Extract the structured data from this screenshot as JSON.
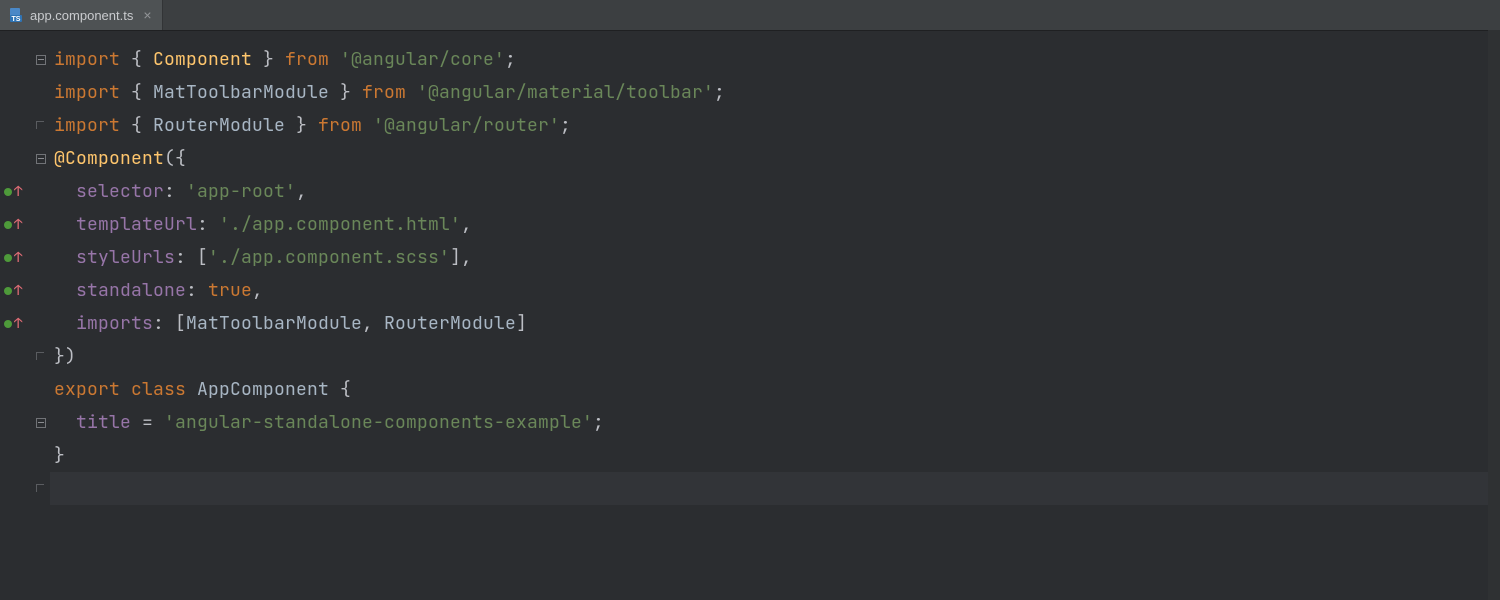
{
  "tab": {
    "filename": "app.component.ts",
    "icon": "ts-file-icon",
    "close": "×"
  },
  "gutter": {
    "vcs_rows": [
      4,
      5,
      6,
      7,
      8
    ],
    "fold_open_rows": [
      0,
      3,
      11
    ],
    "fold_close_rows": [
      2,
      9,
      13
    ]
  },
  "code": {
    "lines": [
      {
        "seg": [
          {
            "c": "kw",
            "t": "import"
          },
          {
            "c": "punc",
            "t": " { "
          },
          {
            "c": "cls",
            "t": "Component"
          },
          {
            "c": "punc",
            "t": " } "
          },
          {
            "c": "kw",
            "t": "from"
          },
          {
            "c": "punc",
            "t": " "
          },
          {
            "c": "str",
            "t": "'@angular/core'"
          },
          {
            "c": "punc",
            "t": ";"
          }
        ]
      },
      {
        "seg": [
          {
            "c": "kw",
            "t": "import"
          },
          {
            "c": "punc",
            "t": " { "
          },
          {
            "c": "plain",
            "t": "MatToolbarModule"
          },
          {
            "c": "punc",
            "t": " } "
          },
          {
            "c": "kw",
            "t": "from"
          },
          {
            "c": "punc",
            "t": " "
          },
          {
            "c": "str",
            "t": "'@angular/material/toolbar'"
          },
          {
            "c": "punc",
            "t": ";"
          }
        ]
      },
      {
        "seg": [
          {
            "c": "kw",
            "t": "import"
          },
          {
            "c": "punc",
            "t": " { "
          },
          {
            "c": "plain",
            "t": "RouterModule"
          },
          {
            "c": "punc",
            "t": " } "
          },
          {
            "c": "kw",
            "t": "from"
          },
          {
            "c": "punc",
            "t": " "
          },
          {
            "c": "str",
            "t": "'@angular/router'"
          },
          {
            "c": "punc",
            "t": ";"
          }
        ]
      },
      {
        "seg": [
          {
            "c": "cls",
            "t": "@Component"
          },
          {
            "c": "punc",
            "t": "({"
          }
        ]
      },
      {
        "indent": 1,
        "seg": [
          {
            "c": "prop",
            "t": "selector"
          },
          {
            "c": "punc",
            "t": ": "
          },
          {
            "c": "str",
            "t": "'app-root'"
          },
          {
            "c": "punc",
            "t": ","
          }
        ]
      },
      {
        "indent": 1,
        "seg": [
          {
            "c": "prop",
            "t": "templateUrl"
          },
          {
            "c": "punc",
            "t": ": "
          },
          {
            "c": "str",
            "t": "'./app.component.html'"
          },
          {
            "c": "punc",
            "t": ","
          }
        ]
      },
      {
        "indent": 1,
        "seg": [
          {
            "c": "prop",
            "t": "styleUrls"
          },
          {
            "c": "punc",
            "t": ": ["
          },
          {
            "c": "str",
            "t": "'./app.component.scss'"
          },
          {
            "c": "punc",
            "t": "],"
          }
        ]
      },
      {
        "indent": 1,
        "seg": [
          {
            "c": "prop",
            "t": "standalone"
          },
          {
            "c": "punc",
            "t": ": "
          },
          {
            "c": "kw",
            "t": "true"
          },
          {
            "c": "punc",
            "t": ","
          }
        ]
      },
      {
        "indent": 1,
        "seg": [
          {
            "c": "prop",
            "t": "imports"
          },
          {
            "c": "punc",
            "t": ": ["
          },
          {
            "c": "plain",
            "t": "MatToolbarModule"
          },
          {
            "c": "punc",
            "t": ", "
          },
          {
            "c": "plain",
            "t": "RouterModule"
          },
          {
            "c": "punc",
            "t": "]"
          }
        ]
      },
      {
        "seg": [
          {
            "c": "punc",
            "t": "})"
          }
        ]
      },
      {
        "seg": [
          {
            "c": "kw",
            "t": "export class"
          },
          {
            "c": "punc",
            "t": " "
          },
          {
            "c": "plain",
            "t": "AppComponent"
          },
          {
            "c": "punc",
            "t": " {"
          }
        ]
      },
      {
        "indent": 1,
        "seg": [
          {
            "c": "prop",
            "t": "title"
          },
          {
            "c": "punc",
            "t": " = "
          },
          {
            "c": "str",
            "t": "'angular-standalone-components-example'"
          },
          {
            "c": "punc",
            "t": ";"
          }
        ]
      },
      {
        "seg": [
          {
            "c": "punc",
            "t": "}"
          }
        ]
      },
      {
        "current": true,
        "seg": []
      }
    ]
  },
  "layout": {
    "line_height": 33,
    "top_pad": 12
  },
  "colors": {
    "bg": "#2b2d30",
    "tabbar": "#3c3f41",
    "tab_active": "#4e5254",
    "keyword": "#cb7832",
    "string": "#6a8759",
    "classname": "#ffc66d",
    "property": "#9775a8",
    "text": "#a8b6c4",
    "vcs_green": "#4e9a3a",
    "vcs_red": "#e06c75"
  }
}
